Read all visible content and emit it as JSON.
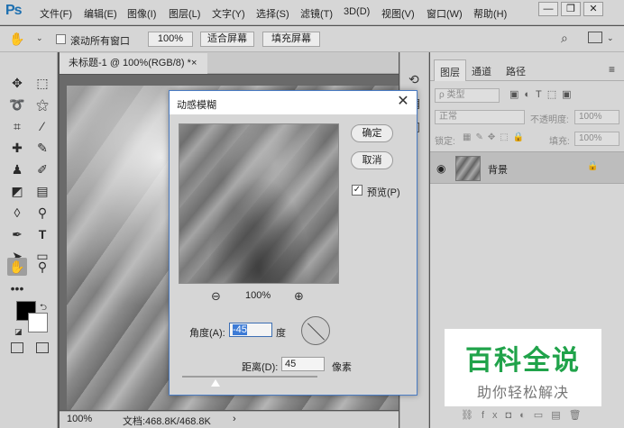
{
  "app": {
    "logo": "Ps"
  },
  "menu": [
    "文件(F)",
    "编辑(E)",
    "图像(I)",
    "图层(L)",
    "文字(Y)",
    "选择(S)",
    "滤镜(T)",
    "3D(D)",
    "视图(V)",
    "窗口(W)",
    "帮助(H)"
  ],
  "window_controls": {
    "minimize": "—",
    "restore": "❐",
    "close": "✕"
  },
  "options": {
    "scroll_all_windows": "滚动所有窗口",
    "zoom_100": "100%",
    "fit_screen": "适合屏幕",
    "fill_screen": "填充屏幕"
  },
  "document": {
    "tab_title": "未标题-1 @ 100%(RGB/8) *",
    "tab_close": "×"
  },
  "status": {
    "zoom": "100%",
    "doc_size": "文档:468.8K/468.8K"
  },
  "layers_panel": {
    "tabs": [
      "图层",
      "通道",
      "路径"
    ],
    "filter_kind": "ρ 类型",
    "blend_mode": "正常",
    "opacity_label": "不透明度:",
    "opacity_value": "100%",
    "lock_label": "锁定:",
    "fill_label": "填充:",
    "fill_value": "100%",
    "layer_name": "背景"
  },
  "dialog": {
    "title": "动感模糊",
    "ok": "确定",
    "cancel": "取消",
    "preview_label": "预览(P)",
    "preview_checked": "✓",
    "zoom_value": "100%",
    "angle_label": "角度(A):",
    "angle_value": "-45",
    "angle_unit": "度",
    "distance_label": "距离(D):",
    "distance_value": "45",
    "distance_unit": "像素"
  },
  "watermark": {
    "title": "百科全说",
    "subtitle": "助你轻松解决"
  }
}
